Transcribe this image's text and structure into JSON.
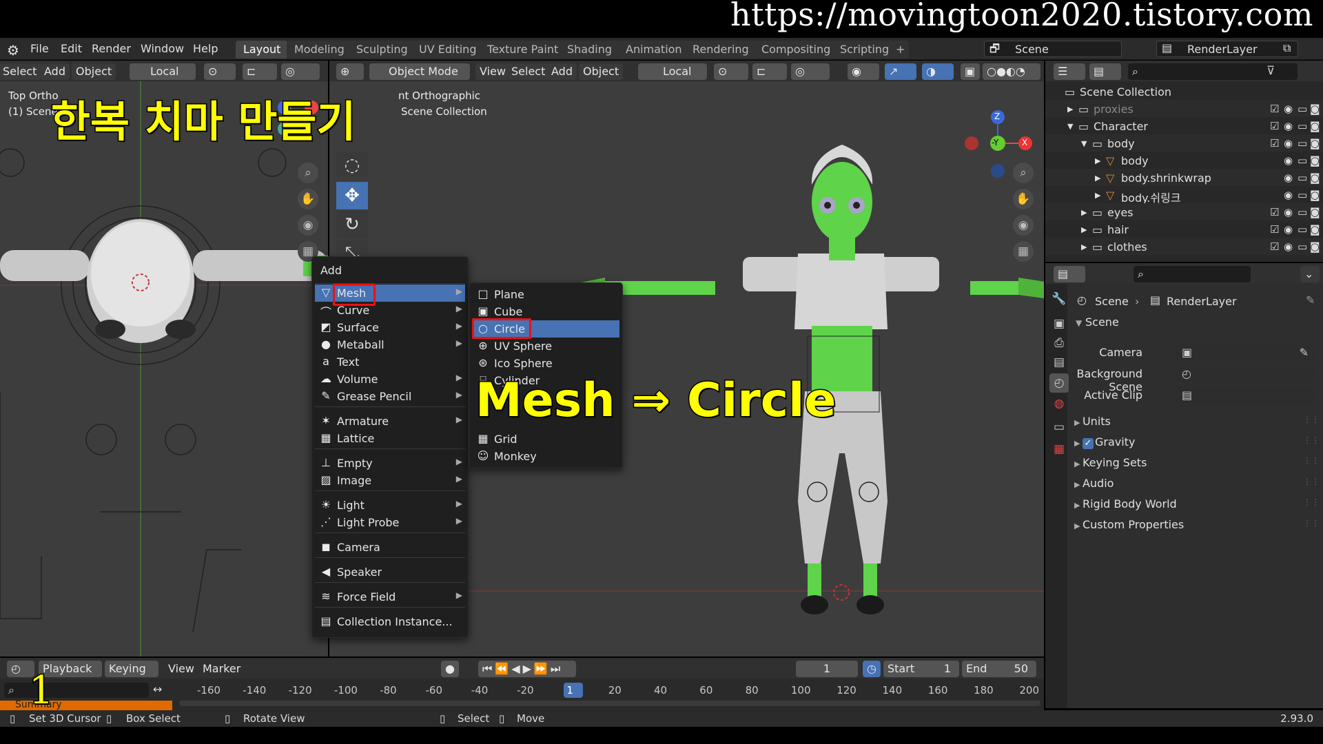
{
  "banner": {
    "url": "https://movingtoon2020.tistory.com"
  },
  "topbar": {
    "menus": [
      "File",
      "Edit",
      "Render",
      "Window",
      "Help"
    ],
    "workspaces": [
      "Layout",
      "Modeling",
      "Sculpting",
      "UV Editing",
      "Texture Paint",
      "Shading",
      "Animation",
      "Rendering",
      "Compositing",
      "Scripting"
    ],
    "active_workspace": "Layout",
    "add_tab": "+",
    "scene_field": "Scene",
    "view_layer_field": "RenderLayer"
  },
  "left_viewport": {
    "header": {
      "select": "Select",
      "add": "Add",
      "object": "Object",
      "orientation": "Local"
    },
    "info_line1": "Top Ortho",
    "info_line2": "(1) Scene"
  },
  "main_viewport": {
    "header": {
      "mode": "Object Mode",
      "view": "View",
      "select": "Select",
      "add": "Add",
      "object": "Object",
      "orientation": "Local"
    },
    "info_line1": "nt Orthographic",
    "info_line2": "Scene Collection",
    "gizmo": {
      "z": "Z",
      "neg_y": "-Y",
      "x": "X"
    }
  },
  "overlay": {
    "title_ko": "한복 치마 만들기",
    "annotation": "Mesh ⇒ Circle"
  },
  "add_menu": {
    "title": "Add",
    "items": [
      {
        "label": "Mesh",
        "icon": "▽",
        "sub": true,
        "highlight": true
      },
      {
        "label": "Curve",
        "icon": "⌒",
        "sub": true
      },
      {
        "label": "Surface",
        "icon": "◩",
        "sub": true
      },
      {
        "label": "Metaball",
        "icon": "●",
        "sub": true
      },
      {
        "label": "Text",
        "icon": "a",
        "sub": false
      },
      {
        "label": "Volume",
        "icon": "☁",
        "sub": true
      },
      {
        "label": "Grease Pencil",
        "icon": "✎",
        "sub": true
      },
      {
        "label": "Armature",
        "icon": "✶",
        "sub": true
      },
      {
        "label": "Lattice",
        "icon": "▦",
        "sub": false
      },
      {
        "label": "Empty",
        "icon": "⊥",
        "sub": true
      },
      {
        "label": "Image",
        "icon": "▨",
        "sub": true
      },
      {
        "label": "Light",
        "icon": "☀",
        "sub": true
      },
      {
        "label": "Light Probe",
        "icon": "⋰",
        "sub": true
      },
      {
        "label": "Camera",
        "icon": "◼",
        "sub": false
      },
      {
        "label": "Speaker",
        "icon": "◀",
        "sub": false
      },
      {
        "label": "Force Field",
        "icon": "≋",
        "sub": true
      },
      {
        "label": "Collection Instance...",
        "icon": "▤",
        "sub": false
      }
    ]
  },
  "mesh_menu": {
    "items": [
      {
        "label": "Plane",
        "icon": "□"
      },
      {
        "label": "Cube",
        "icon": "▣"
      },
      {
        "label": "Circle",
        "icon": "○",
        "highlight": true
      },
      {
        "label": "UV Sphere",
        "icon": "⊕"
      },
      {
        "label": "Ico Sphere",
        "icon": "⊛"
      },
      {
        "label": "Cylinder",
        "icon": "⌸"
      },
      {
        "label": "Grid",
        "icon": "▦"
      },
      {
        "label": "Monkey",
        "icon": "☺"
      }
    ]
  },
  "outliner": {
    "root": "Scene Collection",
    "rows": [
      {
        "name": "proxies",
        "depth": 1,
        "type": "collection",
        "dim": true
      },
      {
        "name": "Character",
        "depth": 1,
        "type": "collection",
        "open": true
      },
      {
        "name": "body",
        "depth": 2,
        "type": "collection",
        "open": true
      },
      {
        "name": "body",
        "depth": 3,
        "type": "mesh"
      },
      {
        "name": "body.shrinkwrap",
        "depth": 3,
        "type": "mesh"
      },
      {
        "name": "body.쉬링크",
        "depth": 3,
        "type": "mesh"
      },
      {
        "name": "eyes",
        "depth": 2,
        "type": "collection"
      },
      {
        "name": "hair",
        "depth": 2,
        "type": "collection"
      },
      {
        "name": "clothes",
        "depth": 2,
        "type": "collection"
      }
    ]
  },
  "properties": {
    "breadcrumb_scene": "Scene",
    "breadcrumb_layer": "RenderLayer",
    "panel_title": "Scene",
    "camera_label": "Camera",
    "background_label": "Background Scene",
    "clip_label": "Active Clip",
    "subpanels": [
      "Units",
      "Gravity",
      "Keying Sets",
      "Audio",
      "Rigid Body World",
      "Custom Properties"
    ],
    "gravity_checked": true
  },
  "timeline": {
    "playback": "Playback",
    "keying": "Keying",
    "view": "View",
    "marker": "Marker",
    "current_frame": "1",
    "start_label": "Start",
    "start_value": "1",
    "end_label": "End",
    "end_value": "50",
    "ticks": [
      "-160",
      "-140",
      "-120",
      "-100",
      "-80",
      "-60",
      "-40",
      "-20",
      "1",
      "20",
      "40",
      "60",
      "80",
      "100",
      "120",
      "140",
      "160",
      "180",
      "200"
    ],
    "summary": "Summary",
    "frame_overlay": "1"
  },
  "statusbar": {
    "items": [
      "Set 3D Cursor",
      "Box Select",
      "Rotate View",
      "Select",
      "Move"
    ],
    "version": "2.93.0"
  },
  "colors": {
    "accent": "#4772b3",
    "annotation": "#ffff00",
    "highlight_box": "#e11111",
    "body_green": "#5fd34a"
  }
}
